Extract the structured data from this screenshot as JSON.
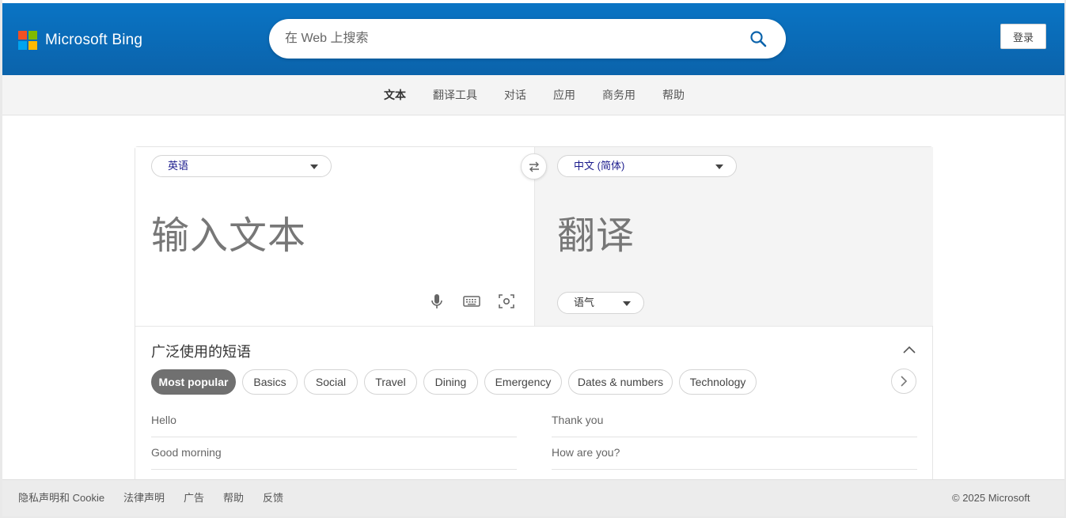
{
  "brand": {
    "name": "Microsoft Bing"
  },
  "search": {
    "placeholder": "在 Web 上搜索"
  },
  "header": {
    "login_label": "登录"
  },
  "nav": {
    "items": [
      {
        "label": "文本",
        "active": true
      },
      {
        "label": "翻译工具"
      },
      {
        "label": "对话"
      },
      {
        "label": "应用"
      },
      {
        "label": "商务用"
      },
      {
        "label": "帮助"
      }
    ]
  },
  "translator": {
    "source_lang": "英语",
    "target_lang": "中文 (简体)",
    "input_placeholder": "输入文本",
    "output_placeholder": "翻译",
    "tone_label": "语气"
  },
  "phrases": {
    "title": "广泛使用的短语",
    "chips": [
      {
        "label": "Most popular",
        "active": true
      },
      {
        "label": "Basics"
      },
      {
        "label": "Social"
      },
      {
        "label": "Travel"
      },
      {
        "label": "Dining"
      },
      {
        "label": "Emergency"
      },
      {
        "label": "Dates & numbers"
      },
      {
        "label": "Technology"
      }
    ],
    "items_left": [
      "Hello",
      "Good morning"
    ],
    "items_right": [
      "Thank you",
      "How are you?"
    ]
  },
  "footer": {
    "links": [
      "隐私声明和 Cookie",
      "法律声明",
      "广告",
      "帮助",
      "反馈"
    ],
    "copyright": "© 2025 Microsoft"
  },
  "colors": {
    "header_blue": "#0b6ab7",
    "logo_red": "#f25022",
    "logo_green": "#7fba00",
    "logo_blue": "#00a4ef",
    "logo_yellow": "#ffb900",
    "search_icon": "#0b63ab"
  }
}
